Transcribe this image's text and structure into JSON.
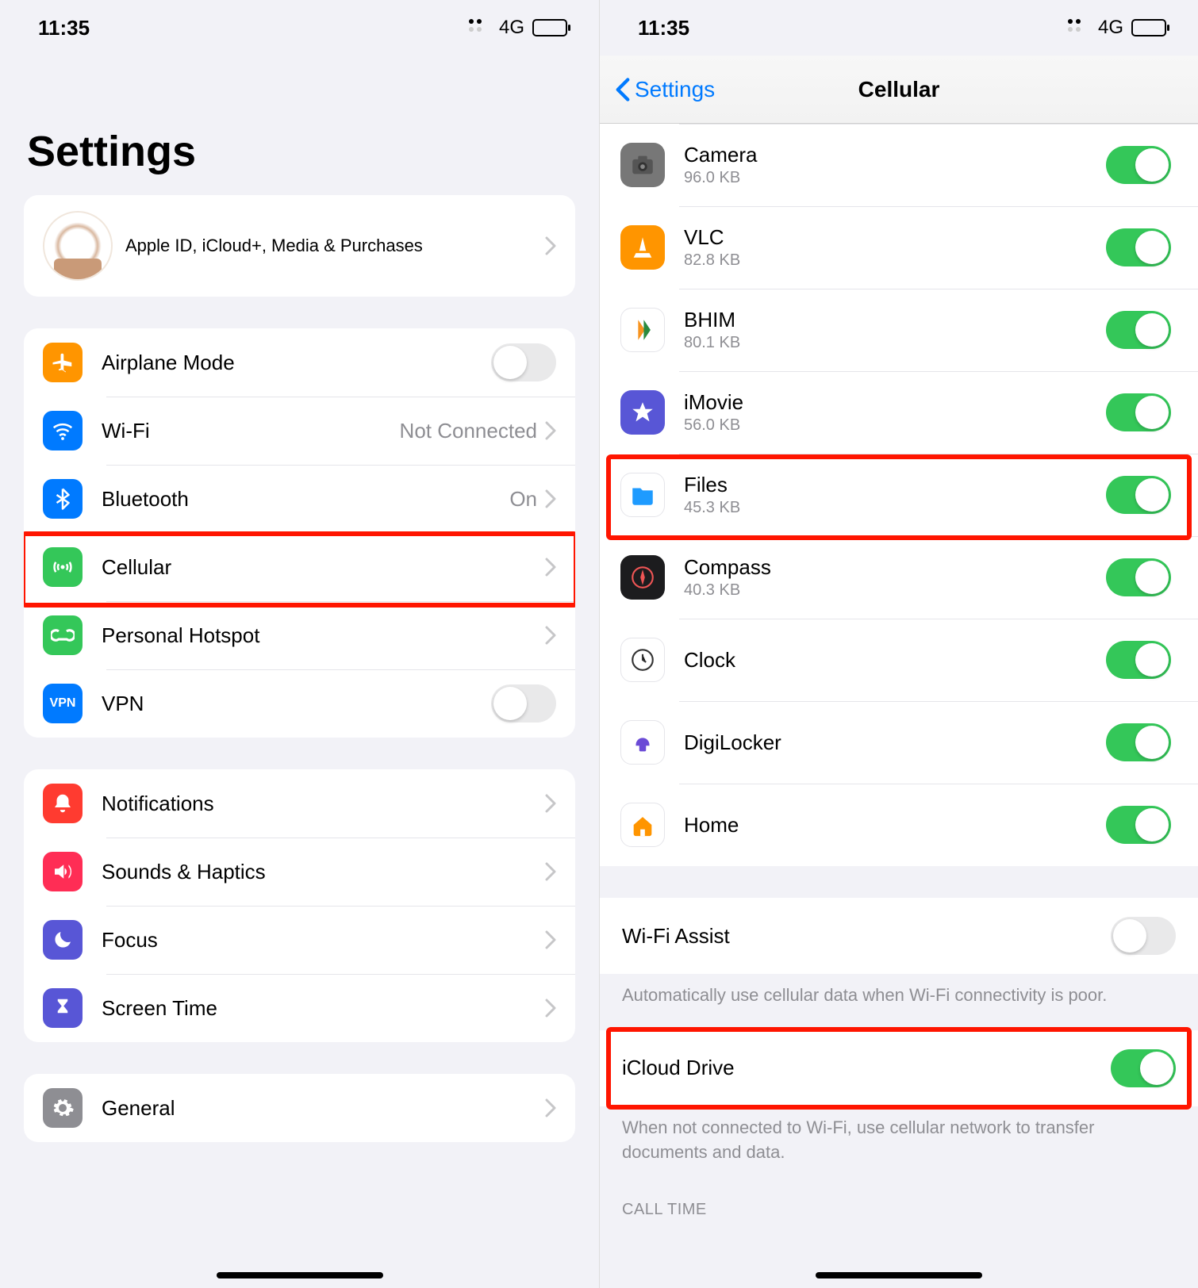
{
  "status": {
    "time": "11:35",
    "network": "4G"
  },
  "left": {
    "title": "Settings",
    "profile": {
      "line": "Apple ID, iCloud+, Media & Purchases"
    },
    "group1": {
      "airplane": {
        "label": "Airplane Mode"
      },
      "wifi": {
        "label": "Wi-Fi",
        "detail": "Not Connected"
      },
      "bluetooth": {
        "label": "Bluetooth",
        "detail": "On"
      },
      "cellular": {
        "label": "Cellular"
      },
      "hotspot": {
        "label": "Personal Hotspot"
      },
      "vpn": {
        "label": "VPN"
      }
    },
    "group2": {
      "notifications": {
        "label": "Notifications"
      },
      "sounds": {
        "label": "Sounds & Haptics"
      },
      "focus": {
        "label": "Focus"
      },
      "screentime": {
        "label": "Screen Time"
      }
    },
    "group3": {
      "general": {
        "label": "General"
      }
    }
  },
  "right": {
    "nav": {
      "back": "Settings",
      "title": "Cellular"
    },
    "apps": [
      {
        "name": "Camera",
        "size": "96.0 KB",
        "icon": "camera",
        "bg": "darkgray"
      },
      {
        "name": "VLC",
        "size": "82.8 KB",
        "icon": "vlc",
        "bg": "orange"
      },
      {
        "name": "BHIM",
        "size": "80.1 KB",
        "icon": "bhim",
        "bg": "white"
      },
      {
        "name": "iMovie",
        "size": "56.0 KB",
        "icon": "star",
        "bg": "purple"
      },
      {
        "name": "Files",
        "size": "45.3 KB",
        "icon": "folder",
        "bg": "white"
      },
      {
        "name": "Compass",
        "size": "40.3 KB",
        "icon": "compass",
        "bg": "black"
      },
      {
        "name": "Clock",
        "size": "",
        "icon": "clock",
        "bg": "white"
      },
      {
        "name": "DigiLocker",
        "size": "",
        "icon": "digilocker",
        "bg": "white"
      },
      {
        "name": "Home",
        "size": "",
        "icon": "home",
        "bg": "white"
      }
    ],
    "wifi_assist": {
      "label": "Wi-Fi Assist",
      "note": "Automatically use cellular data when Wi-Fi connectivity is poor."
    },
    "icloud_drive": {
      "label": "iCloud Drive",
      "note": "When not connected to Wi-Fi, use cellular network to transfer documents and data."
    },
    "call_time_header": "CALL TIME"
  }
}
